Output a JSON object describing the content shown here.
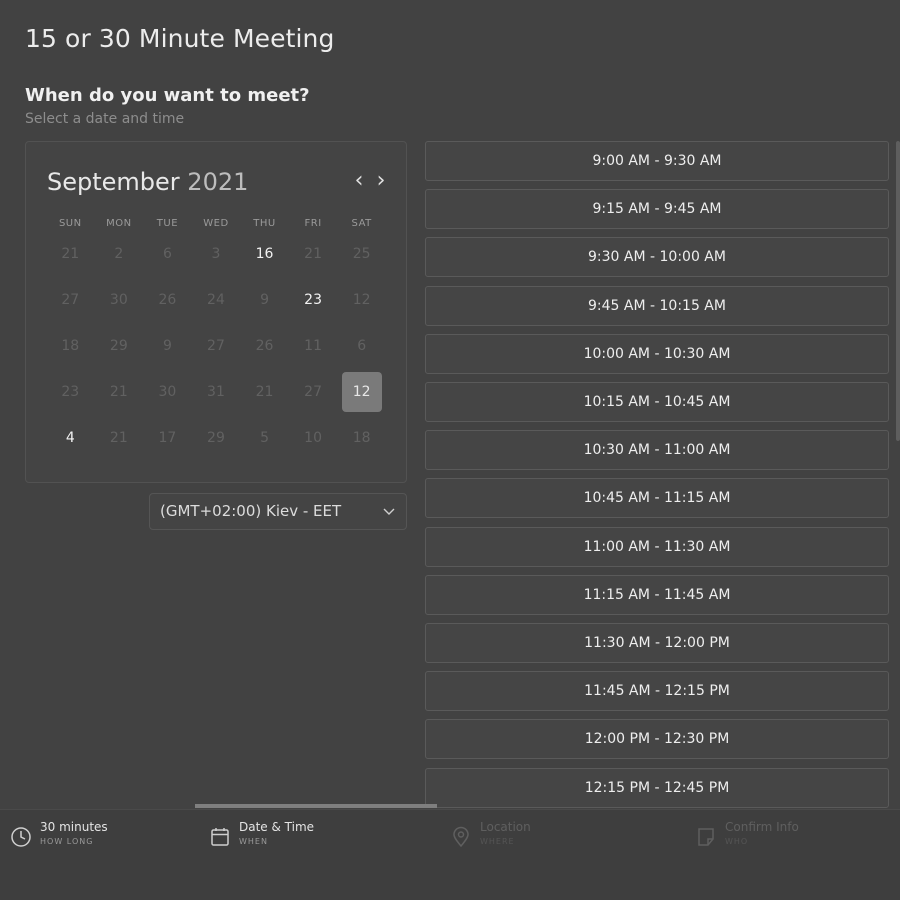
{
  "header": {
    "title": "15 or 30 Minute Meeting",
    "question": "When do you want to meet?",
    "hint": "Select a date and time"
  },
  "calendar": {
    "month": "September",
    "year": "2021",
    "prev_icon": "chevron-left-icon",
    "next_icon": "chevron-right-icon",
    "weekdays": [
      "SUN",
      "MON",
      "TUE",
      "WED",
      "THU",
      "FRI",
      "SAT"
    ],
    "weeks": [
      [
        {
          "d": "21"
        },
        {
          "d": "2"
        },
        {
          "d": "6"
        },
        {
          "d": "3"
        },
        {
          "d": "16",
          "avail": true
        },
        {
          "d": "21"
        },
        {
          "d": "25"
        }
      ],
      [
        {
          "d": "27"
        },
        {
          "d": "30"
        },
        {
          "d": "26"
        },
        {
          "d": "24"
        },
        {
          "d": "9"
        },
        {
          "d": "23",
          "avail": true
        },
        {
          "d": "12"
        }
      ],
      [
        {
          "d": "18"
        },
        {
          "d": "29"
        },
        {
          "d": "9"
        },
        {
          "d": "27"
        },
        {
          "d": "26"
        },
        {
          "d": "11"
        },
        {
          "d": "6"
        }
      ],
      [
        {
          "d": "23"
        },
        {
          "d": "21"
        },
        {
          "d": "30"
        },
        {
          "d": "31"
        },
        {
          "d": "21"
        },
        {
          "d": "27"
        },
        {
          "d": "12",
          "selected": true
        }
      ],
      [
        {
          "d": "4",
          "avail": true
        },
        {
          "d": "21"
        },
        {
          "d": "17"
        },
        {
          "d": "29"
        },
        {
          "d": "5"
        },
        {
          "d": "10"
        },
        {
          "d": "18"
        }
      ]
    ]
  },
  "timezone": {
    "value": "(GMT+02:00) Kiev - EET",
    "icon": "chevron-down-icon"
  },
  "slots": [
    "9:00 AM - 9:30 AM",
    "9:15 AM - 9:45 AM",
    "9:30 AM - 10:00 AM",
    "9:45 AM - 10:15 AM",
    "10:00 AM - 10:30 AM",
    "10:15 AM - 10:45 AM",
    "10:30 AM - 11:00 AM",
    "10:45 AM - 11:15 AM",
    "11:00 AM - 11:30 AM",
    "11:15 AM - 11:45 AM",
    "11:30 AM - 12:00 PM",
    "11:45 AM - 12:15 PM",
    "12:00 PM - 12:30 PM",
    "12:15 PM - 12:45 PM"
  ],
  "steps": [
    {
      "label": "30 minutes",
      "sub": "HOW LONG",
      "icon": "clock-icon",
      "active": true
    },
    {
      "label": "Date & Time",
      "sub": "WHEN",
      "icon": "calendar-icon",
      "active": true
    },
    {
      "label": "Location",
      "sub": "WHERE",
      "icon": "map-pin-icon",
      "active": false
    },
    {
      "label": "Confirm Info",
      "sub": "WHO",
      "icon": "note-icon",
      "active": false
    }
  ],
  "colors": {
    "background": "#424242",
    "selected_day": "#7a7a7a",
    "progress": "#7f7f7f"
  }
}
